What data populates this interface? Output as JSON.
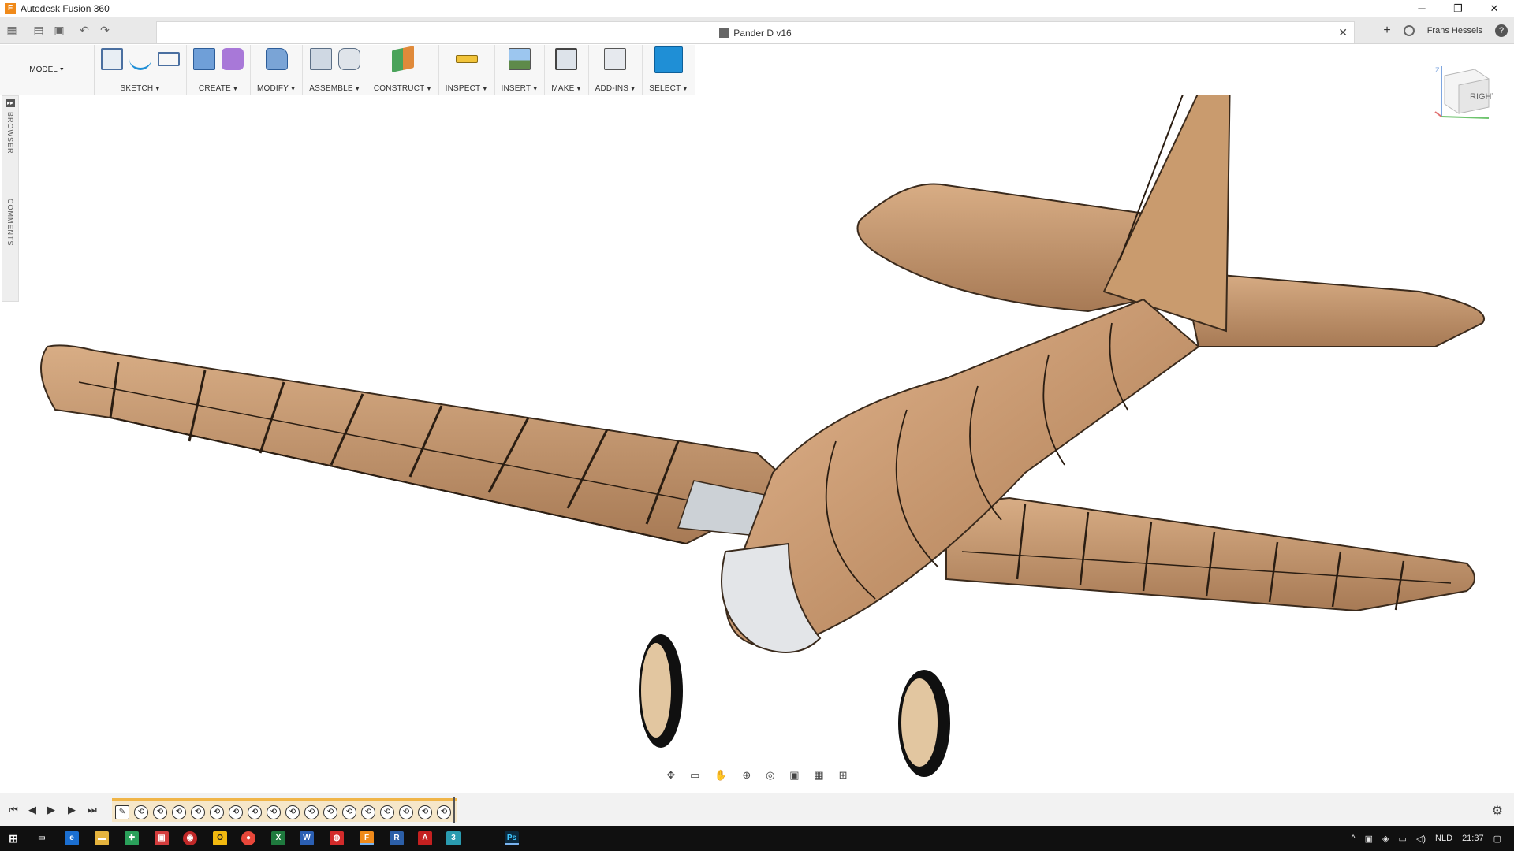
{
  "window": {
    "title": "Autodesk Fusion 360",
    "minimize": "─",
    "restore": "❐",
    "close": "✕"
  },
  "apptabs": {
    "document_tab": "Pander D v16",
    "close": "✕",
    "new_tab": "+",
    "user_name": "Frans Hessels",
    "help": "?"
  },
  "ribbon": {
    "workspace": "MODEL",
    "groups": [
      {
        "label": "SKETCH"
      },
      {
        "label": "CREATE"
      },
      {
        "label": "MODIFY"
      },
      {
        "label": "ASSEMBLE"
      },
      {
        "label": "CONSTRUCT"
      },
      {
        "label": "INSPECT"
      },
      {
        "label": "INSERT"
      },
      {
        "label": "MAKE"
      },
      {
        "label": "ADD-INS"
      },
      {
        "label": "SELECT"
      }
    ]
  },
  "side_panel": {
    "browser": "BROWSER",
    "comments": "COMMENTS"
  },
  "viewcube": {
    "face": "RIGHT",
    "z": "Z"
  },
  "colors": {
    "wood": "#c79a72",
    "wood_dark": "#8c6446",
    "accent_blue": "#1f8fd6",
    "timeline_accent": "#f0b548"
  },
  "taskbar": {
    "language": "NLD",
    "time": "21:37"
  }
}
